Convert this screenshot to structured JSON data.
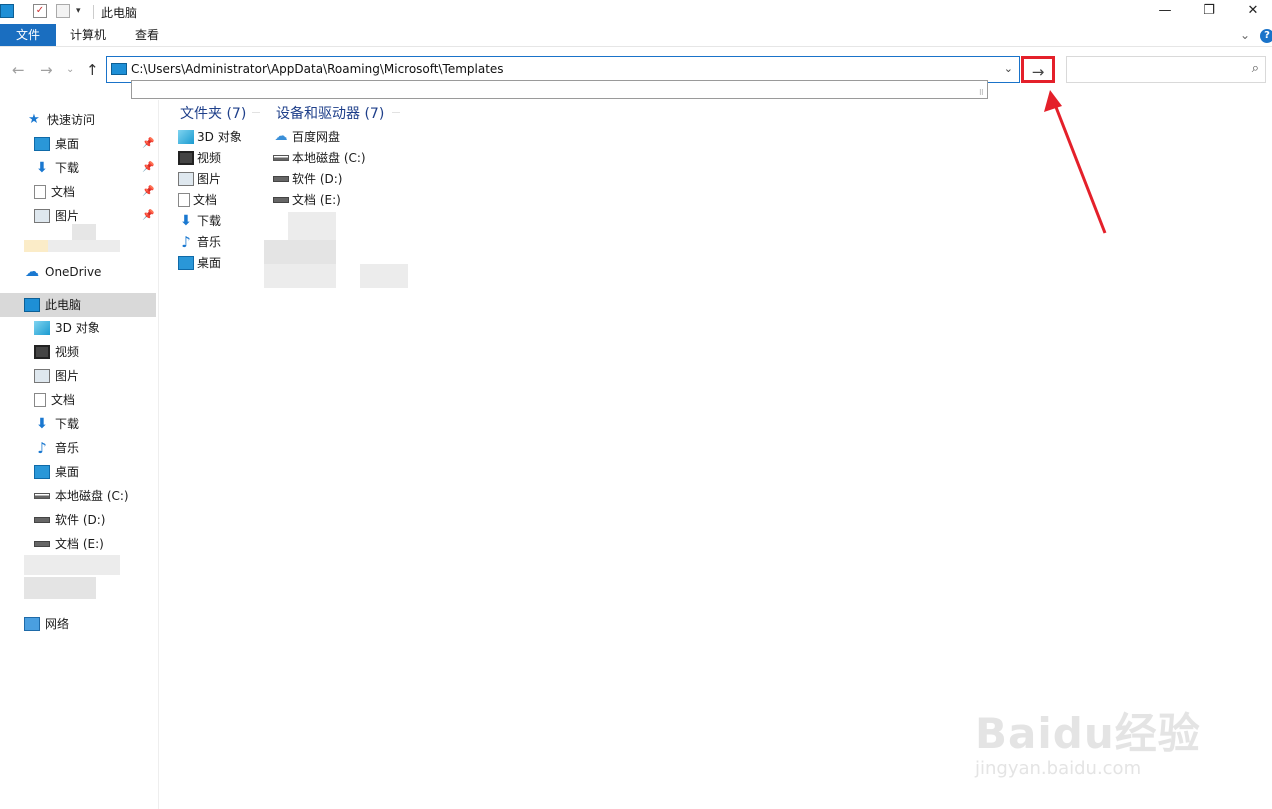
{
  "window": {
    "title": "此电脑",
    "minimize": "—",
    "restore": "❐",
    "close": "✕"
  },
  "ribbon": {
    "tabs": [
      "文件",
      "计算机",
      "查看"
    ],
    "collapse": "⌄",
    "help": "?"
  },
  "nav": {
    "back": "←",
    "forward": "→",
    "recent": "⌄",
    "up": "↑",
    "address_value": "C:\\Users\\Administrator\\AppData\\Roaming\\Microsoft\\Templates",
    "address_dropdown": "⌄",
    "go": "→",
    "search_placeholder": "",
    "search_icon": "⌕"
  },
  "sidebar": {
    "quick_access": "快速访问",
    "quick_items": [
      "桌面",
      "下载",
      "文档",
      "图片"
    ],
    "onedrive": "OneDrive",
    "this_pc": "此电脑",
    "pc_items": [
      "3D 对象",
      "视频",
      "图片",
      "文档",
      "下载",
      "音乐",
      "桌面",
      "本地磁盘 (C:)",
      "软件 (D:)",
      "文档 (E:)"
    ],
    "network": "网络"
  },
  "content": {
    "folders_header": "文件夹 (7)",
    "devices_header": "设备和驱动器 (7)",
    "folders": [
      "3D 对象",
      "视频",
      "图片",
      "文档",
      "下载",
      "音乐",
      "桌面"
    ],
    "devices": [
      "百度网盘",
      "本地磁盘 (C:)",
      "软件 (D:)",
      "文档 (E:)"
    ]
  },
  "watermark": {
    "main": "Baidu经验",
    "sub": "jingyan.baidu.com"
  },
  "colors": {
    "accent": "#1a73c9",
    "file_tab": "#1a6ec0",
    "highlight": "#e4202a",
    "selected_bg": "#d9d9d9"
  }
}
